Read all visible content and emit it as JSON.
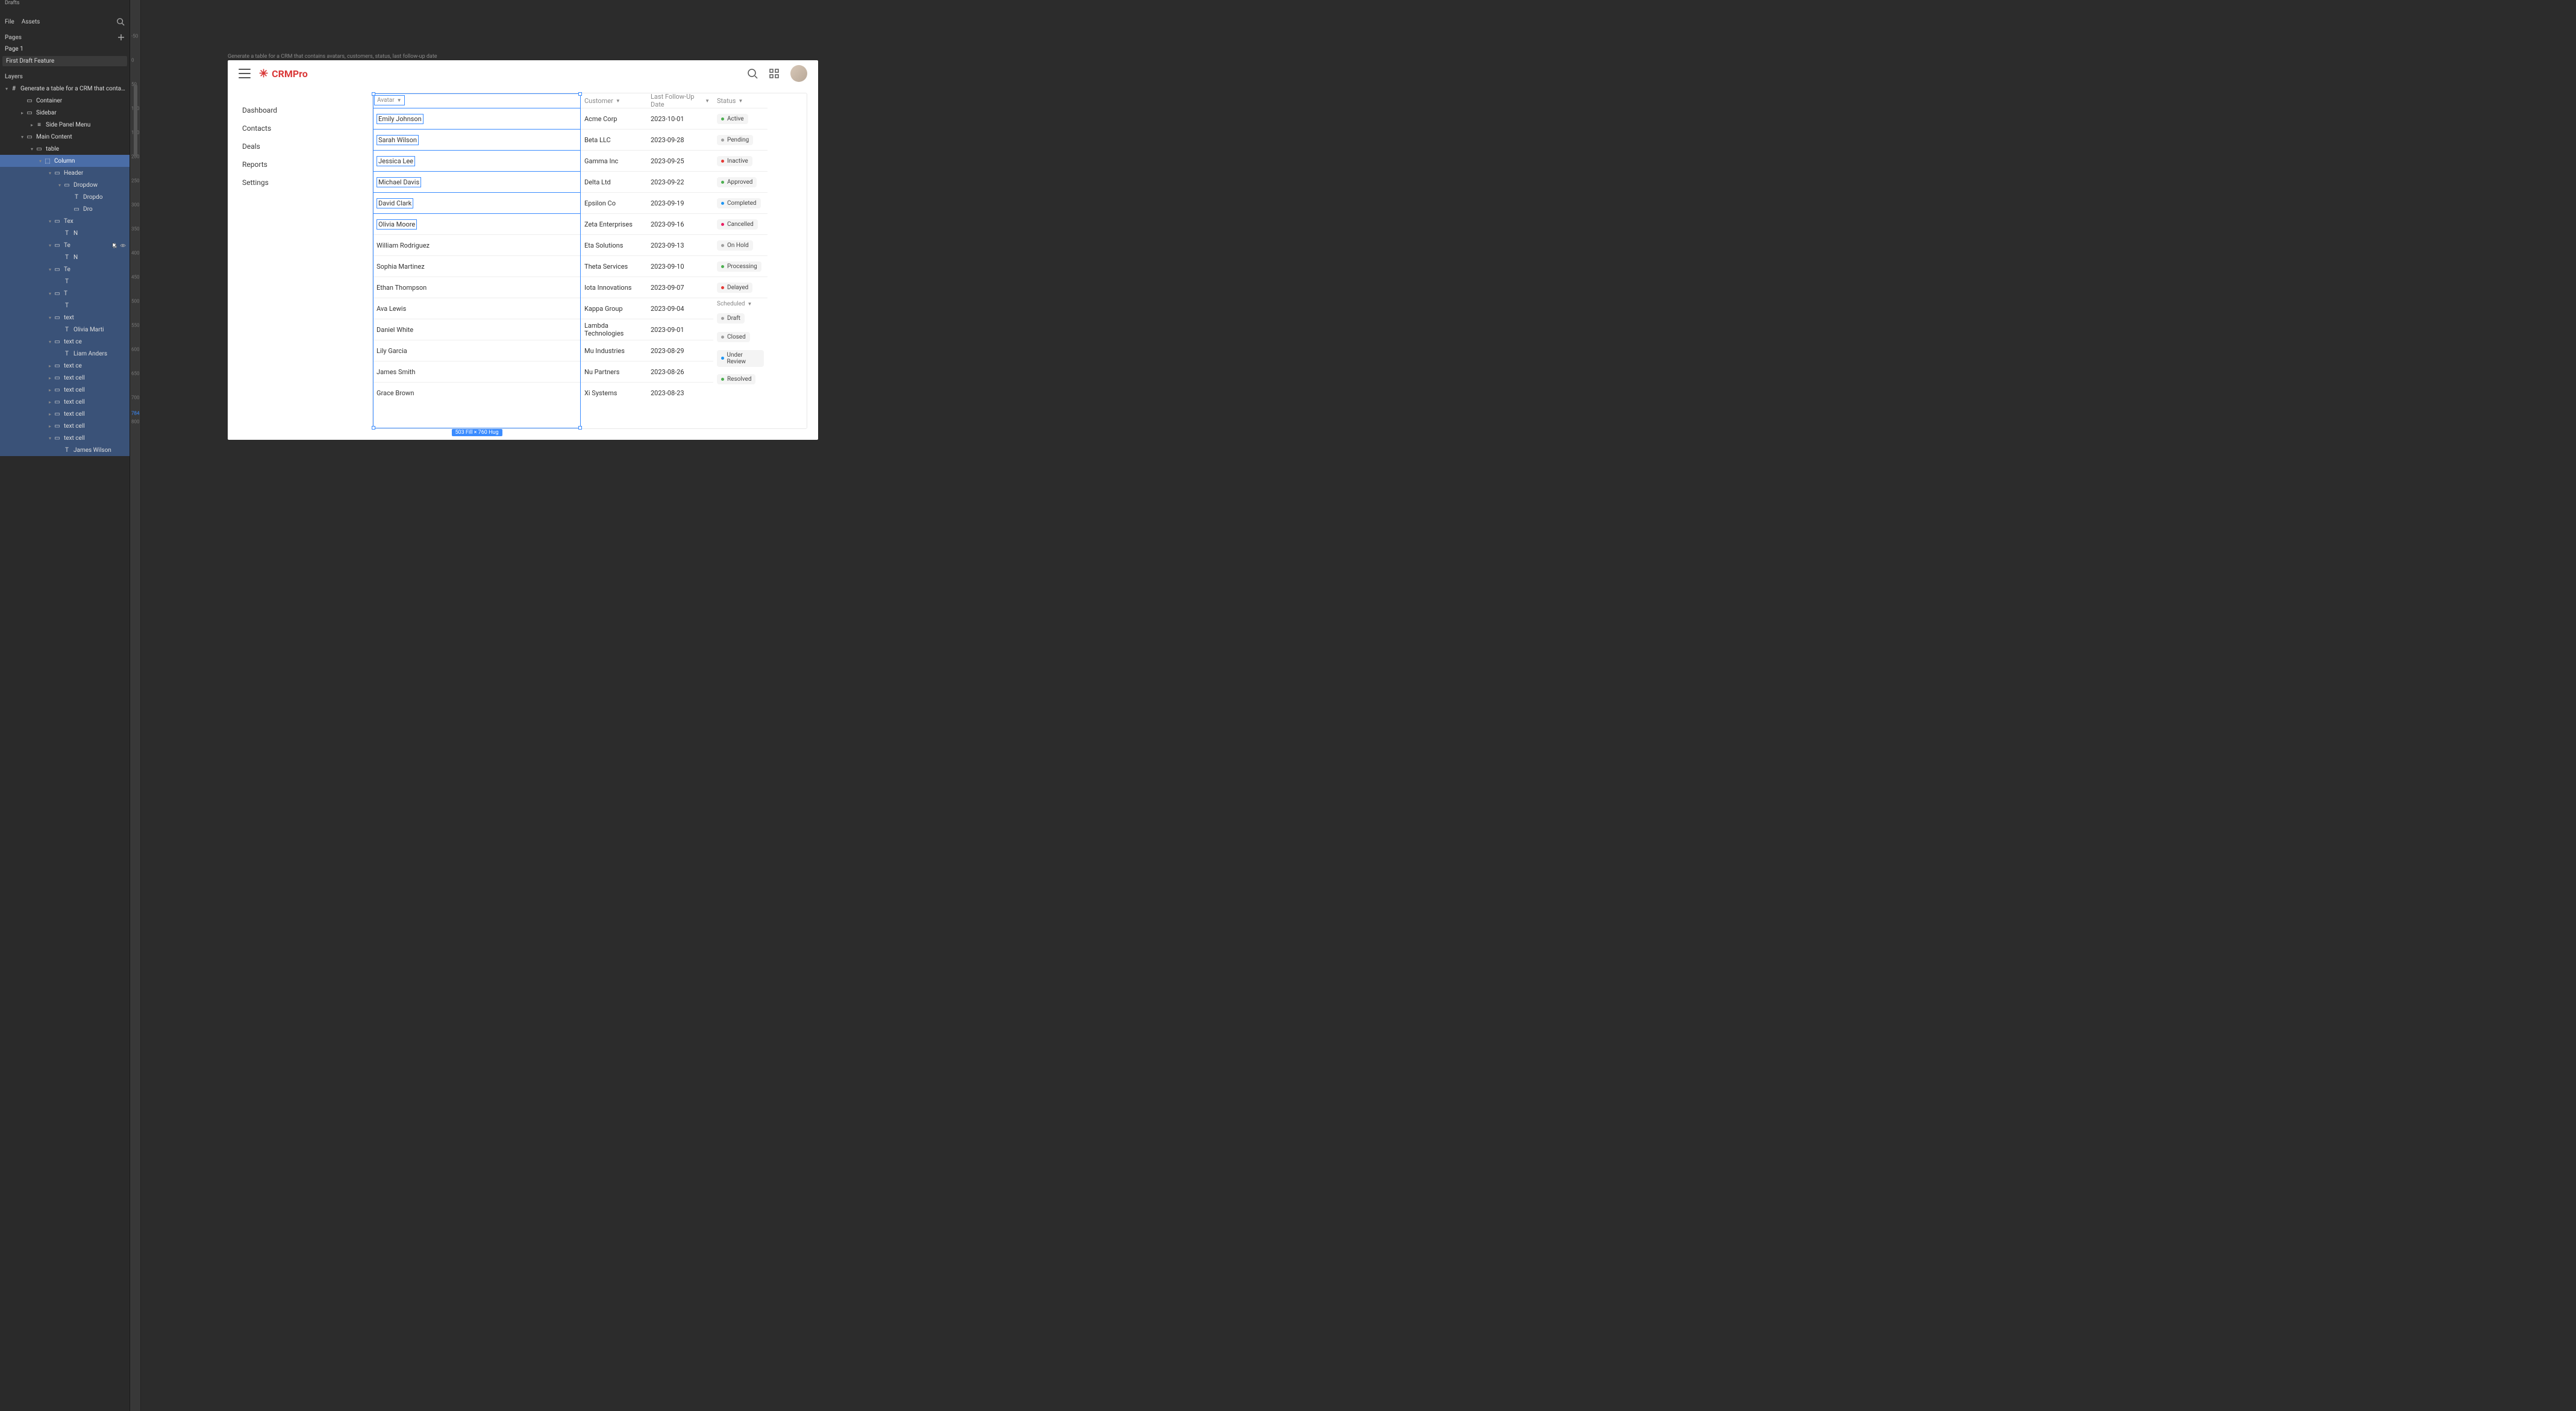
{
  "figma": {
    "drafts": "Drafts",
    "file_tab": "File",
    "assets_tab": "Assets",
    "pages_label": "Pages",
    "pages": [
      "Page 1",
      "First Draft Feature"
    ],
    "layers_label": "Layers",
    "frame_layer": "Generate a table for a CRM that contains avatars, c...",
    "tree": {
      "container": "Container",
      "sidebar": "Sidebar",
      "sidepanel": "Side Panel Menu",
      "maincontent": "Main Content",
      "table": "table",
      "column": "Column",
      "header": "Header",
      "dropdow": "Dropdow",
      "dropdo": "Dropdo",
      "dro": "Dro",
      "tex": "Tex",
      "n1": "N",
      "te1": "Te",
      "n2": "N",
      "te2": "Te",
      "t": "T",
      "textrow": "text",
      "olivia": "Olivia Marti",
      "textce1": "text ce",
      "liam": "Liam Anders",
      "textce2": "text ce",
      "cell1": "text cell",
      "cell2": "text cell",
      "cell3": "text cell",
      "cell4": "text cell",
      "cell5": "text cell",
      "cell6": "text cell",
      "james": "James Wilson"
    },
    "ruler": [
      "-50",
      "0",
      "50",
      "100",
      "150",
      "200",
      "250",
      "300",
      "350",
      "400",
      "450",
      "500",
      "550",
      "600",
      "650",
      "700",
      "784",
      "800"
    ]
  },
  "canvas": {
    "frame_title": "Generate a table for a CRM that contains avatars, customers, status,  last follow-up date"
  },
  "crm": {
    "logo": "CRMPro",
    "sidebar": [
      "Dashboard",
      "Contacts",
      "Deals",
      "Reports",
      "Settings"
    ],
    "headers": {
      "avatar": "Avatar",
      "customer": "Customer",
      "date": "Last Follow-Up Date",
      "status": "Status"
    },
    "avatar_names": [
      "Emily Johnson",
      "Sarah Wilson",
      "Jessica Lee",
      "Michael Davis",
      "David Clark",
      "Olivia Moore",
      "William Rodriguez",
      "Sophia Martinez",
      "Ethan Thompson",
      "Ava Lewis",
      "Daniel White",
      "Lily Garcia",
      "James Smith",
      "Grace Brown"
    ],
    "customers": [
      "Acme Corp",
      "Beta LLC",
      "Gamma Inc",
      "Delta Ltd",
      "Epsilon Co",
      "Zeta Enterprises",
      "Eta Solutions",
      "Theta Services",
      "Iota Innovations",
      "Kappa Group",
      "Lambda Technologies",
      "Mu Industries",
      "Nu Partners",
      "Xi Systems"
    ],
    "dates": [
      "2023-10-01",
      "2023-09-28",
      "2023-09-25",
      "2023-09-22",
      "2023-09-19",
      "2023-09-16",
      "2023-09-13",
      "2023-09-10",
      "2023-09-07",
      "2023-09-04",
      "2023-09-01",
      "2023-08-29",
      "2023-08-26",
      "2023-08-23"
    ],
    "statuses": [
      {
        "label": "Active",
        "dot": "green"
      },
      {
        "label": "Pending",
        "dot": "gray"
      },
      {
        "label": "Inactive",
        "dot": "red"
      },
      {
        "label": "Approved",
        "dot": "green"
      },
      {
        "label": "Completed",
        "dot": "blue"
      },
      {
        "label": "Cancelled",
        "dot": "pink"
      },
      {
        "label": "On Hold",
        "dot": "gray"
      },
      {
        "label": "Processing",
        "dot": "green"
      },
      {
        "label": "Delayed",
        "dot": "red"
      }
    ],
    "status_open": "Scheduled",
    "status_menu": [
      {
        "label": "Draft",
        "dot": "gray"
      },
      {
        "label": "Closed",
        "dot": "gray"
      },
      {
        "label": "Under Review",
        "dot": "blue"
      },
      {
        "label": "Resolved",
        "dot": "green"
      }
    ],
    "size_pill": "503 Fill × 760 Hug"
  }
}
